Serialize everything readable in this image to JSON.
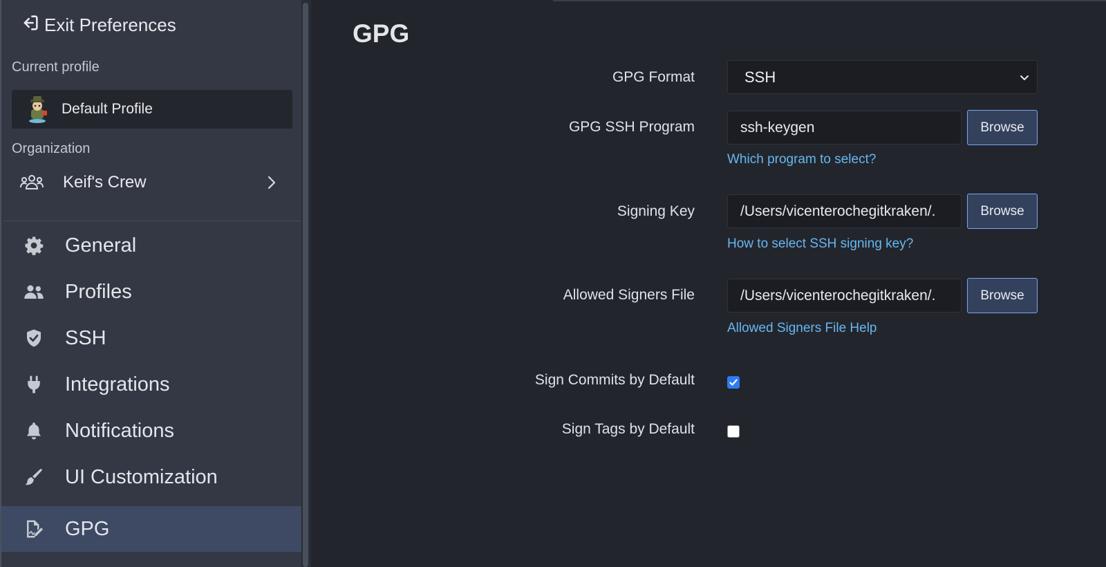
{
  "sidebar": {
    "exit_label": "Exit Preferences",
    "current_profile_heading": "Current profile",
    "profile_name": "Default Profile",
    "organization_heading": "Organization",
    "organization_name": "Keif's Crew",
    "nav": [
      {
        "label": "General",
        "icon": "gear-icon"
      },
      {
        "label": "Profiles",
        "icon": "users-icon"
      },
      {
        "label": "SSH",
        "icon": "shield-icon"
      },
      {
        "label": "Integrations",
        "icon": "plug-icon"
      },
      {
        "label": "Notifications",
        "icon": "bell-icon"
      },
      {
        "label": "UI Customization",
        "icon": "brush-icon"
      },
      {
        "label": "GPG",
        "icon": "signature-icon",
        "active": true
      }
    ]
  },
  "main": {
    "title": "GPG",
    "gpg_format": {
      "label": "GPG Format",
      "value": "SSH"
    },
    "gpg_ssh_program": {
      "label": "GPG SSH Program",
      "value": "ssh-keygen",
      "button": "Browse",
      "help": "Which program to select?"
    },
    "signing_key": {
      "label": "Signing Key",
      "value": "/Users/vicenterochegitkraken/.",
      "button": "Browse",
      "help": "How to select SSH signing key?"
    },
    "allowed_signers": {
      "label": "Allowed Signers File",
      "value": "/Users/vicenterochegitkraken/.",
      "button": "Browse",
      "help": "Allowed Signers File Help"
    },
    "sign_commits": {
      "label": "Sign Commits by Default",
      "checked": true
    },
    "sign_tags": {
      "label": "Sign Tags by Default",
      "checked": false
    }
  },
  "colors": {
    "accent": "#2f7bf2",
    "link": "#65b8f0",
    "active_nav": "#3e4a63"
  }
}
